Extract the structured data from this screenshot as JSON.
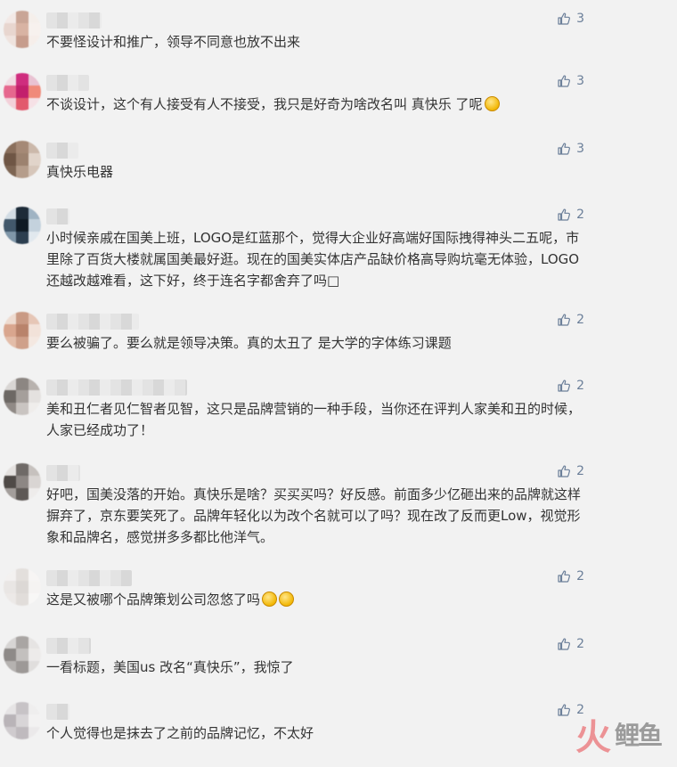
{
  "comments": [
    {
      "text": "不要怪设计和推广，领导不同意也放不出来",
      "likes": "3",
      "emoji": 0
    },
    {
      "text": "不谈设计，这个有人接受有人不接受，我只是好奇为啥改名叫 真快乐 了呢",
      "likes": "3",
      "emoji": 1
    },
    {
      "text": "真快乐电器",
      "likes": "3",
      "emoji": 0
    },
    {
      "text": "小时候亲戚在国美上班，LOGO是红蓝那个，觉得大企业好高端好国际拽得神头二五呢，市里除了百货大楼就属国美最好逛。现在的国美实体店产品缺价格高导购坑毫无体验，LOGO还越改越难看，这下好，终于连名字都舍弃了吗□",
      "likes": "2",
      "emoji": 0
    },
    {
      "text": "要么被骗了。要么就是领导决策。真的太丑了 是大学的字体练习课题",
      "likes": "2",
      "emoji": 0
    },
    {
      "text": "美和丑仁者见仁智者见智，这只是品牌营销的一种手段，当你还在评判人家美和丑的时候，人家已经成功了！",
      "likes": "2",
      "emoji": 0
    },
    {
      "text": "好吧，国美没落的开始。真快乐是啥？买买买吗？好反感。前面多少亿砸出来的品牌就这样摒弃了，京东要笑死了。品牌年轻化以为改个名就可以了吗？现在改了反而更Low，视觉形象和品牌名，感觉拼多多都比他洋气。",
      "likes": "2",
      "emoji": 0
    },
    {
      "text": "这是又被哪个品牌策划公司忽悠了吗",
      "likes": "2",
      "emoji": 2
    },
    {
      "text": "一看标题，美国us 改名“真快乐”，我惊了",
      "likes": "2",
      "emoji": 0
    },
    {
      "text": "个人觉得也是抹去了之前的品牌记忆，不太好",
      "likes": "2",
      "emoji": 0
    }
  ],
  "watermark": {
    "glyph": "火",
    "text": "鲤鱼"
  },
  "icons": {
    "like": "thumbs-up-icon"
  },
  "colors": {
    "like": "#6b7f99",
    "text": "#333333",
    "background": "#f2f2f2"
  }
}
